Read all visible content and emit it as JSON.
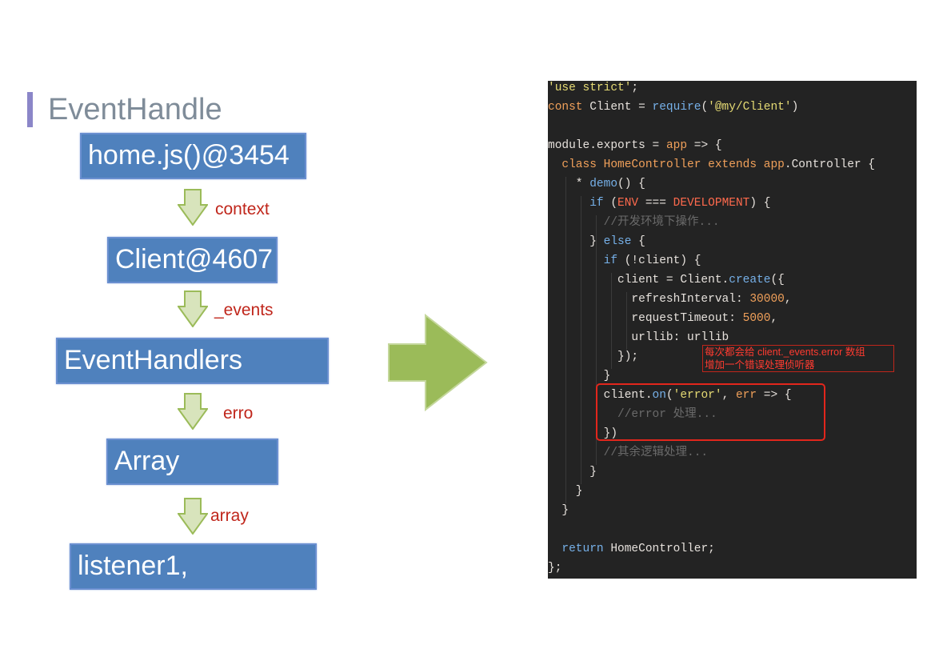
{
  "title": "EventHandle",
  "flow": {
    "boxes": [
      "home.js()@3454",
      "Client@4607",
      "EventHandlers",
      "Array",
      "listener1,"
    ],
    "arrow_labels": [
      "context",
      "_events",
      "erro",
      "array"
    ]
  },
  "code": {
    "lines": [
      [
        [
          "'use strict'",
          "#e6db74"
        ],
        [
          ";",
          "#e6e1dc"
        ]
      ],
      [
        [
          "const",
          "#f0a05a"
        ],
        [
          " Client = ",
          "#e6e1dc"
        ],
        [
          "require",
          "#76b0e8"
        ],
        [
          "(",
          "#e6e1dc"
        ],
        [
          "'@my/Client'",
          "#e6db74"
        ],
        [
          ")",
          "#e6e1dc"
        ]
      ],
      [],
      [
        [
          "module.exports = ",
          "#e6e1dc"
        ],
        [
          "app",
          "#f0a05a"
        ],
        [
          " => {",
          "#e6e1dc"
        ]
      ],
      [
        [
          "  ",
          "#e6e1dc"
        ],
        [
          "class",
          "#f0a05a"
        ],
        [
          " ",
          "#e6e1dc"
        ],
        [
          "HomeController",
          "#f0a05a"
        ],
        [
          " ",
          "#e6e1dc"
        ],
        [
          "extends",
          "#f0a05a"
        ],
        [
          " ",
          "#e6e1dc"
        ],
        [
          "app",
          "#f0a05a"
        ],
        [
          ".Controller {",
          "#e6e1dc"
        ]
      ],
      [
        [
          "    * ",
          "#e6e1dc"
        ],
        [
          "demo",
          "#76b0e8"
        ],
        [
          "() {",
          "#e6e1dc"
        ]
      ],
      [
        [
          "      ",
          "#e6e1dc"
        ],
        [
          "if",
          "#76b0e8"
        ],
        [
          " (",
          "#e6e1dc"
        ],
        [
          "ENV",
          "#ff6a4d"
        ],
        [
          " === ",
          "#e6e1dc"
        ],
        [
          "DEVELOPMENT",
          "#ff6a4d"
        ],
        [
          ") {",
          "#e6e1dc"
        ]
      ],
      [
        [
          "        //开发环境下操作...",
          "#6a6a6a"
        ]
      ],
      [
        [
          "      } ",
          "#e6e1dc"
        ],
        [
          "else",
          "#76b0e8"
        ],
        [
          " {",
          "#e6e1dc"
        ]
      ],
      [
        [
          "        ",
          "#e6e1dc"
        ],
        [
          "if",
          "#76b0e8"
        ],
        [
          " (!client) {",
          "#e6e1dc"
        ]
      ],
      [
        [
          "          client = Client.",
          "#e6e1dc"
        ],
        [
          "create",
          "#76b0e8"
        ],
        [
          "({",
          "#e6e1dc"
        ]
      ],
      [
        [
          "            refreshInterval: ",
          "#e6e1dc"
        ],
        [
          "30000",
          "#f0a05a"
        ],
        [
          ",",
          "#e6e1dc"
        ]
      ],
      [
        [
          "            requestTimeout: ",
          "#e6e1dc"
        ],
        [
          "5000",
          "#f0a05a"
        ],
        [
          ",",
          "#e6e1dc"
        ]
      ],
      [
        [
          "            urllib: urllib",
          "#e6e1dc"
        ]
      ],
      [
        [
          "          });",
          "#e6e1dc"
        ]
      ],
      [
        [
          "        }",
          "#e6e1dc"
        ]
      ],
      [
        [
          "        client.",
          "#e6e1dc"
        ],
        [
          "on",
          "#76b0e8"
        ],
        [
          "(",
          "#e6e1dc"
        ],
        [
          "'error'",
          "#e6db74"
        ],
        [
          ", ",
          "#e6e1dc"
        ],
        [
          "err",
          "#f0a05a"
        ],
        [
          " => {",
          "#e6e1dc"
        ]
      ],
      [
        [
          "          //error 处理...",
          "#6a6a6a"
        ]
      ],
      [
        [
          "        })",
          "#e6e1dc"
        ]
      ],
      [
        [
          "        //其余逻辑处理...",
          "#6a6a6a"
        ]
      ],
      [
        [
          "      }",
          "#e6e1dc"
        ]
      ],
      [
        [
          "    }",
          "#e6e1dc"
        ]
      ],
      [
        [
          "  }",
          "#e6e1dc"
        ]
      ],
      [],
      [
        [
          "  ",
          "#e6e1dc"
        ],
        [
          "return",
          "#76b0e8"
        ],
        [
          " HomeController;",
          "#e6e1dc"
        ]
      ],
      [
        [
          "};",
          "#e6e1dc"
        ]
      ]
    ],
    "annotation": [
      "每次都会给 client._events.error 数组",
      "增加一个错误处理侦听器"
    ]
  },
  "colors": {
    "box_fill": "#4f81bd",
    "arrow_fill": "#9bbb59",
    "label_red": "#c0261b",
    "code_bg": "#232323",
    "highlight_red": "#e2261c"
  }
}
